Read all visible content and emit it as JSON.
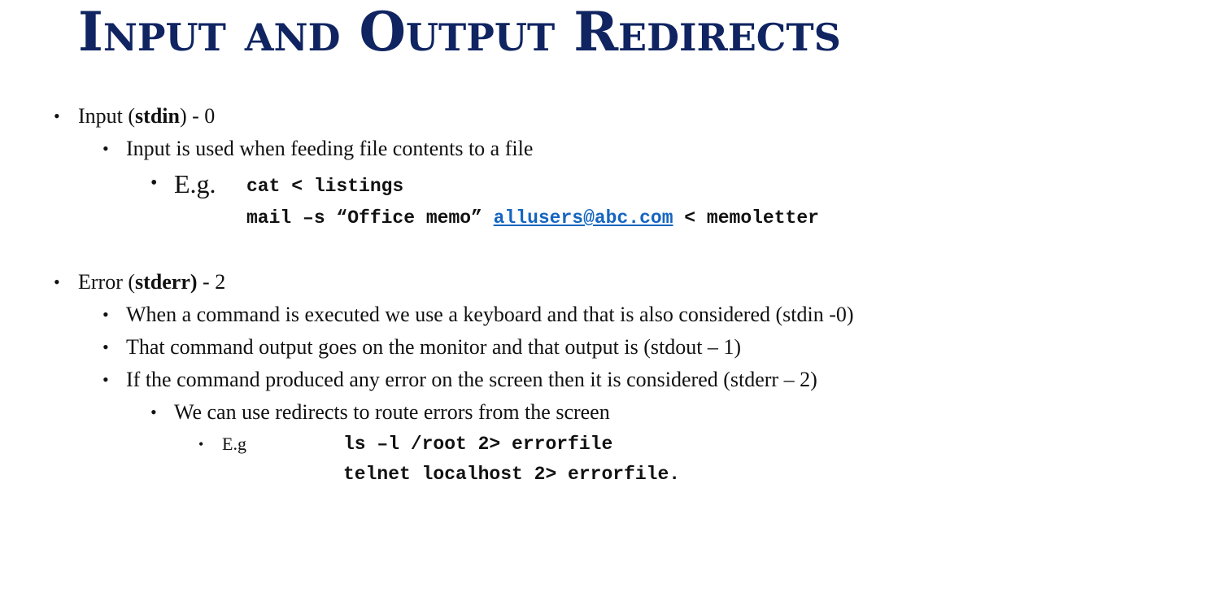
{
  "title": "Input and Output Redirects",
  "colors": {
    "title": "#0f2461",
    "link": "#1565c0",
    "text": "#111111"
  },
  "input": {
    "label_pre": "Input (",
    "label_bold": "stdin",
    "label_post": ") - 0",
    "sub": "Input is used when feeding file contents to a file",
    "eg_label": "E.g.",
    "cmd1": "cat < listings",
    "cmd2_pre": "mail –s “Office memo” ",
    "cmd2_link": "allusers@abc.com",
    "cmd2_post": " < memoletter"
  },
  "error": {
    "label_pre": "Error (",
    "label_bold": "stderr)",
    "label_post": " - 2",
    "sub1": "When a command is executed we use a keyboard and that is also considered (stdin -0)",
    "sub2": "That command output goes on the monitor and that output is (stdout – 1)",
    "sub3": "If the command produced any error on the screen then it is considered (stderr – 2)",
    "sub3a": "We can use redirects to route errors from the screen",
    "eg_label": "E.g",
    "cmd1": "ls –l /root 2> errorfile",
    "cmd2": "telnet localhost 2> errorfile."
  }
}
